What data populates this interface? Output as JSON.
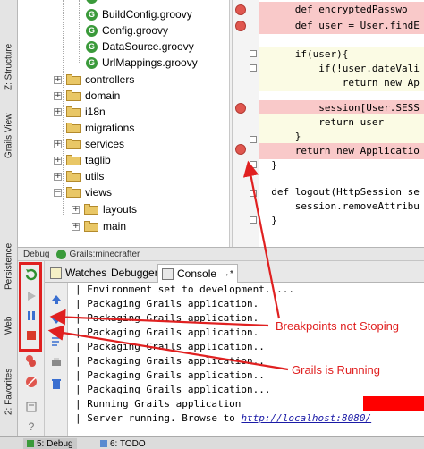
{
  "left_strip": {
    "structure": "Z: Structure",
    "grails_view": "Grails View",
    "persistence": "Persistence",
    "web": "Web",
    "favorites": "2: Favorites"
  },
  "tree": {
    "files": [
      "BuildConfig.groovy",
      "Config.groovy",
      "DataSource.groovy",
      "UrlMappings.groovy"
    ],
    "folders": [
      "controllers",
      "domain",
      "i18n",
      "migrations",
      "services",
      "taglib",
      "utils",
      "views"
    ],
    "subfolders": [
      "layouts",
      "main"
    ]
  },
  "editor": {
    "lines": [
      {
        "pre": "def encryptedPasswo",
        "kind": "hl"
      },
      {
        "pre": "def user = User.findE",
        "kind": "hl"
      },
      {
        "pre": "if(user){",
        "kind": "yhl"
      },
      {
        "pre": "if(!user.dateVali",
        "kind": "yhl"
      },
      {
        "pre": "return new Ap",
        "kind": "yhl"
      },
      {
        "pre": "session[User.SESS",
        "kind": "hl"
      },
      {
        "pre": "return user",
        "kind": "yhl"
      },
      {
        "pre": "}",
        "kind": "yhl"
      },
      {
        "pre": "return new Applicatio",
        "kind": "hl"
      },
      {
        "pre": "}",
        "kind": ""
      },
      {
        "pre": "def logout(HttpSession se",
        "kind": ""
      },
      {
        "pre": "session.removeAttribu",
        "kind": ""
      },
      {
        "pre": "}",
        "kind": ""
      }
    ]
  },
  "debug": {
    "header_label": "Debug",
    "run_config": "Grails:minecrafter",
    "tabs": {
      "watches": "Watches",
      "debugger": "Debugger",
      "console": "Console",
      "console_suffix": "→*"
    }
  },
  "console": {
    "lines": [
      "| Environment set to development.....",
      "| Packaging Grails application.",
      "| Packaging Grails application.",
      "| Packaging Grails application.",
      "| Packaging Grails application..",
      "| Packaging Grails application..",
      "| Packaging Grails application..",
      "| Packaging Grails application...",
      "| Running Grails application"
    ],
    "server_prefix": "| Server running. Browse to ",
    "server_link": "http://localhost:8080/"
  },
  "bottom_tabs": {
    "debug": "5: Debug",
    "todo": "6: TODO"
  },
  "annotations": {
    "breakpoints": "Breakpoints not Stoping",
    "running": "Grails is Running"
  },
  "colors": {
    "annotation_red": "#e02020",
    "breakpoint": "#e0574f",
    "breakpoint_line": "#f9c9c9"
  }
}
